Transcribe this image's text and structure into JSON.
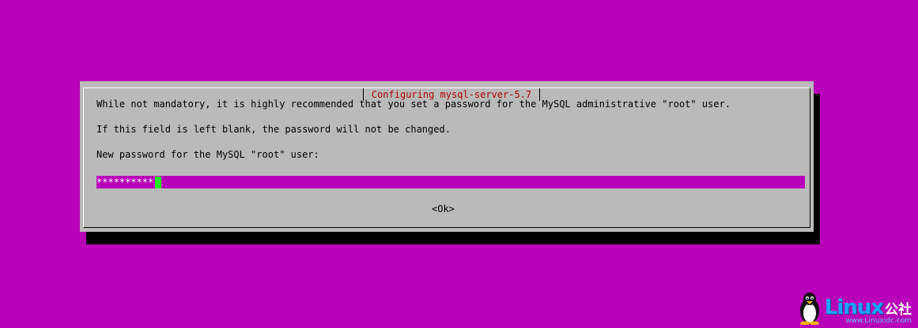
{
  "dialog": {
    "title": "Configuring mysql-server-5.7",
    "lines": [
      "While not mandatory, it is highly recommended that you set a password for the MySQL administrative \"root\" user.",
      "If this field is left blank, the password will not be changed.",
      "New password for the MySQL \"root\" user:"
    ],
    "password_value": "**********",
    "ok_label": "<Ok>"
  },
  "watermark": {
    "logo_word": "Linux",
    "logo_suffix": "公社",
    "url": "www.Linuxidc.com",
    "icon": "penguin-icon"
  },
  "colors": {
    "background": "#b800b8",
    "dialog": "#bababa",
    "title": "#b00000",
    "input_field": "#b800b8",
    "cursor": "#22ee22"
  }
}
